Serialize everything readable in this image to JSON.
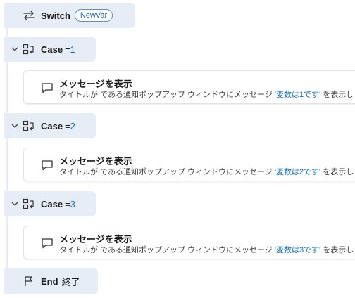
{
  "switch": {
    "keyword": "Switch",
    "variable": "NewVar"
  },
  "cases": [
    {
      "keyword": "Case",
      "operator": "=",
      "value": "1",
      "action": {
        "title": "メッセージを表示",
        "desc_before": "タイトルが  である通知ポップアップ ウィンドウにメッセージ ",
        "desc_value": "'変数は1です'",
        "desc_after": " を表示します"
      }
    },
    {
      "keyword": "Case",
      "operator": "=",
      "value": "2",
      "action": {
        "title": "メッセージを表示",
        "desc_before": "タイトルが  である通知ポップアップ ウィンドウにメッセージ ",
        "desc_value": "'変数は2です'",
        "desc_after": " を表示します"
      }
    },
    {
      "keyword": "Case",
      "operator": "=",
      "value": "3",
      "action": {
        "title": "メッセージを表示",
        "desc_before": "タイトルが  である通知ポップアップ ウィンドウにメッセージ ",
        "desc_value": "'変数は3です'",
        "desc_after": " を表示します"
      }
    }
  ],
  "end": {
    "keyword": "End",
    "label": "終了"
  },
  "icons": {
    "switch": "switch-arrows-icon",
    "case": "case-branch-icon",
    "collapse": "chevron-down-icon",
    "message": "message-bubble-icon",
    "end": "flag-icon"
  },
  "colors": {
    "block_bg": "#e6edf7",
    "accent": "#0f6cbd"
  }
}
